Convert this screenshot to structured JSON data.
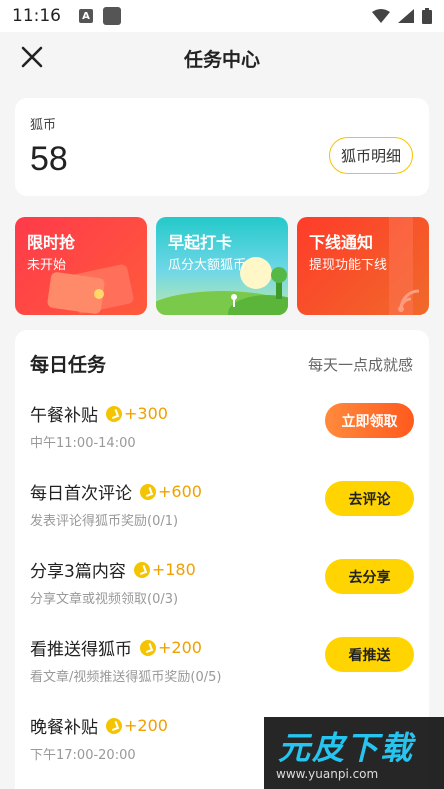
{
  "status_bar": {
    "time": "11:16",
    "a_icon": "A"
  },
  "nav": {
    "title": "任务中心"
  },
  "coins": {
    "label": "狐币",
    "value": "58",
    "detail_button": "狐币明细"
  },
  "banners": [
    {
      "title": "限时抢",
      "subtitle": "未开始"
    },
    {
      "title": "早起打卡",
      "subtitle": "瓜分大额狐币"
    },
    {
      "title": "下线通知",
      "subtitle": "提现功能下线"
    }
  ],
  "daily_tasks": {
    "title": "每日任务",
    "hint": "每天一点成就感",
    "items": [
      {
        "name": "午餐补贴",
        "reward": "+300",
        "desc": "中午11:00-14:00",
        "button": "立即领取"
      },
      {
        "name": "每日首次评论",
        "reward": "+600",
        "desc": "发表评论得狐币奖励(0/1)",
        "button": "去评论"
      },
      {
        "name": "分享3篇内容",
        "reward": "+180",
        "desc": "分享文章或视频领取(0/3)",
        "button": "去分享"
      },
      {
        "name": "看推送得狐币",
        "reward": "+200",
        "desc": "看文章/视频推送得狐币奖励(0/5)",
        "button": "看推送"
      },
      {
        "name": "晚餐补贴",
        "reward": "+200",
        "desc": "下午17:00-20:00"
      }
    ]
  },
  "watermark": {
    "main": "元皮下载",
    "url": "www.yuanpi.com"
  },
  "colors": {
    "accent_yellow": "#ffd400",
    "reward_orange": "#f0a000",
    "claim_orange": "#ff6a28"
  }
}
